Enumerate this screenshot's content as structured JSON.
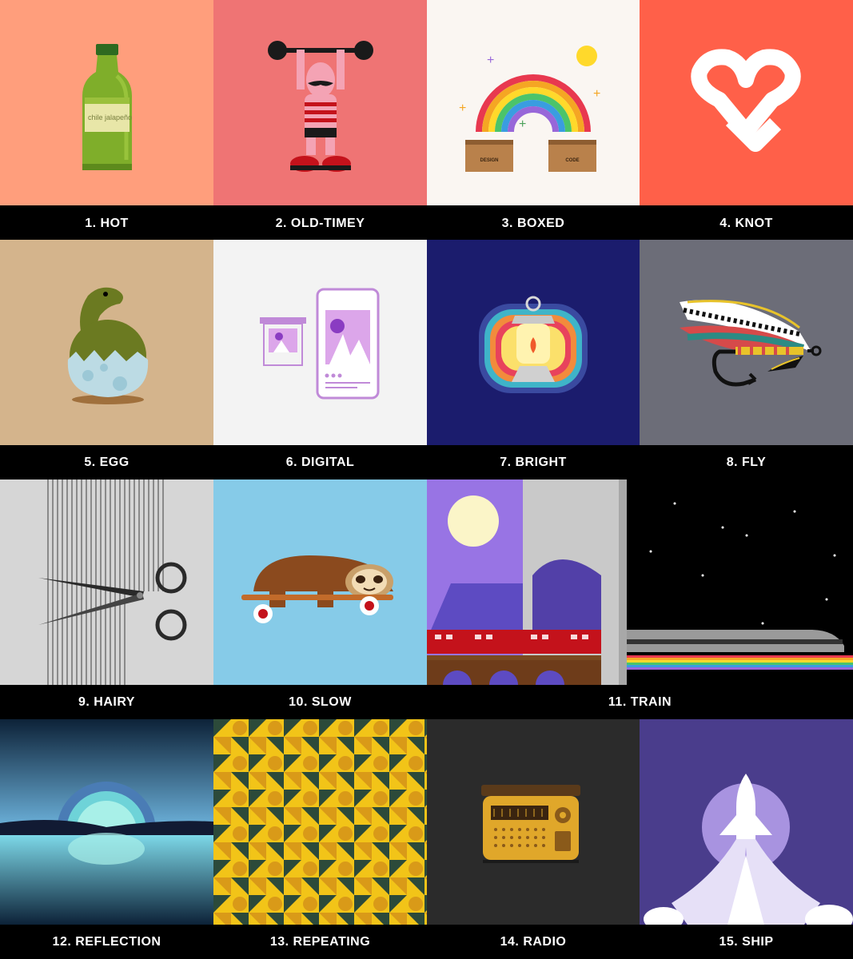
{
  "gallery": {
    "items": [
      {
        "number": 1,
        "label": "1. HOT",
        "bottle_text": "chile jalapeño"
      },
      {
        "number": 2,
        "label": "2. OLD-TIMEY"
      },
      {
        "number": 3,
        "label": "3. BOXED",
        "box_left": "DESIGN",
        "box_right": "CODE"
      },
      {
        "number": 4,
        "label": "4. KNOT"
      },
      {
        "number": 5,
        "label": "5. EGG"
      },
      {
        "number": 6,
        "label": "6. DIGITAL"
      },
      {
        "number": 7,
        "label": "7. BRIGHT"
      },
      {
        "number": 8,
        "label": "8. FLY"
      },
      {
        "number": 9,
        "label": "9. HAIRY"
      },
      {
        "number": 10,
        "label": "10. SLOW"
      },
      {
        "number": 11,
        "label": "11. TRAIN"
      },
      {
        "number": 12,
        "label": "12. REFLECTION"
      },
      {
        "number": 13,
        "label": "13. REPEATING"
      },
      {
        "number": 14,
        "label": "14. RADIO"
      },
      {
        "number": 15,
        "label": "15. SHIP"
      }
    ],
    "colors": {
      "hot": "#ff9e7c",
      "old_timey": "#ef7474",
      "boxed": "#faf6f2",
      "knot": "#ff6049",
      "egg": "#d4b48c",
      "digital": "#f3f3f3",
      "bright": "#1b1c6d",
      "fly": "#6c6d78",
      "hairy": "#d6d6d6",
      "slow": "#86cbe8",
      "train_sky": "#9874e4",
      "ship": "#4a3d8c",
      "label_bar": "#000000"
    }
  }
}
